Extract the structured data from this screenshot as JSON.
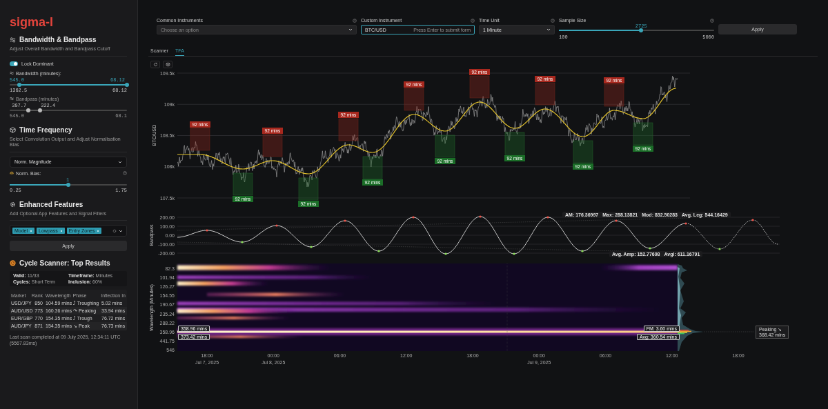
{
  "logo": "sigma-l",
  "bandwidth_section": {
    "title": "Bandwidth & Bandpass",
    "subtitle": "Adjust Overall Bandwidth and Bandpass Cutoff",
    "toggle": {
      "label": "Lock Dominant",
      "on": true
    },
    "bandwidth": {
      "label": "Bandwidth (minutes):",
      "disabled": false,
      "thumbs": [
        {
          "value": "545.0",
          "level": 0.08
        },
        {
          "value": "68.12",
          "level": 1
        }
      ],
      "min": "1362.5",
      "max": "68.12"
    },
    "bandpass": {
      "label": "Bandpass (minutes)",
      "disabled": true,
      "thumbs": [
        {
          "value": "397.7",
          "level": 0.16
        },
        {
          "value": "322.4",
          "level": 0.26
        }
      ],
      "min": "545.0",
      "max": "68.1"
    }
  },
  "time_frequency": {
    "title": "Time Frequency",
    "subtitle": "Select Convolution Output and Adjust Normalisation Bias",
    "select": "Norm. Magnitude",
    "bias": {
      "label": "Norm. Bias:",
      "value": "1",
      "level": 0.5,
      "min": "0.25",
      "max": "1.75"
    }
  },
  "enhanced_features": {
    "title": "Enhanced Features",
    "subtitle": "Add Optional App Features and Signal Filters",
    "tags": [
      "Model",
      "Lowpass",
      "Entry Zones"
    ],
    "apply": "Apply"
  },
  "cycle_scanner": {
    "title": "Cycle Scanner: Top Results",
    "info": [
      "**Valid:** 11/33",
      "**Timeframe:** Minutes",
      "**Cycles:** Short Term",
      "**Inclusion:** 60%"
    ],
    "columns": [
      "Market",
      "Rank",
      "Wavelength",
      "Phase",
      "Inflection In"
    ],
    "rows": [
      [
        "USD/JPY",
        "850",
        "104.59 mins",
        "⤴ Troughing",
        "5.02 mins"
      ],
      [
        "AUD/USD",
        "773",
        "160.36 mins",
        "↷ Peaking",
        "33.94 mins"
      ],
      [
        "EUR/GBP",
        "770",
        "154.35 mins",
        "⤴ Trough",
        "76.72 mins"
      ],
      [
        "AUD/JPY",
        "871",
        "154.35 mins",
        "↘ Peak",
        "76.73 mins"
      ]
    ],
    "footer": "Last scan completed at 09 July 2025, 12:34:11 UTC (5567.83ms)"
  },
  "form": {
    "fields": [
      {
        "kind": "select",
        "label": "Common Instruments",
        "placeholder": "Choose an option"
      },
      {
        "kind": "text",
        "label": "Custom Instrument",
        "value": "BTC/USD",
        "hint": "Press Enter to submit form"
      },
      {
        "kind": "select",
        "label": "Time Unit",
        "value": "1 Minute"
      },
      {
        "kind": "slider",
        "label": "Sample Size",
        "value": "2725",
        "level": 0.53,
        "min": "100",
        "max": "5000"
      }
    ],
    "apply": "Apply"
  },
  "tabs": [
    {
      "label": "Scanner",
      "selected": false
    },
    {
      "label": "TFA",
      "selected": true
    }
  ],
  "price_chart": {
    "ylabel": "BTC/USD",
    "yticks": [
      "109.5k",
      "109k",
      "108.5k",
      "108k",
      "107.5k"
    ],
    "zones": [
      {
        "kind": "peak",
        "label": "92 mins"
      },
      {
        "kind": "trough",
        "label": "92 mins"
      },
      {
        "kind": "peak",
        "label": "92 mins"
      },
      {
        "kind": "trough",
        "label": "92 mins"
      },
      {
        "kind": "peak",
        "label": "92 mins"
      },
      {
        "kind": "trough",
        "label": "92 mins"
      },
      {
        "kind": "peak",
        "label": "92 mins"
      },
      {
        "kind": "trough",
        "label": "92 mins"
      },
      {
        "kind": "peak",
        "label": "92 mins"
      },
      {
        "kind": "trough",
        "label": "92 mins"
      },
      {
        "kind": "peak",
        "label": "92 mins"
      },
      {
        "kind": "trough",
        "label": "92 mins"
      },
      {
        "kind": "peak",
        "label": "92 mins"
      },
      {
        "kind": "trough",
        "label": "92 mins"
      }
    ]
  },
  "bandpass_chart": {
    "ylabel": "Bandpass",
    "yticks": [
      "200.00",
      "100.00",
      "0.00",
      "-100.00",
      "-200.00"
    ],
    "stats_top": [
      "AM: 176.36997",
      "Max: 288.13821",
      "Mod: 832.50283",
      "Avg. Leg: 544.16429"
    ],
    "stats_bottom": [
      "Avg. Amp: 152.77698",
      "AvgI: 611.16791"
    ]
  },
  "spectrogram": {
    "ylabel": "Wavelength (Minutes)",
    "yticks": [
      "82.3",
      "101.94",
      "126.27",
      "154.55",
      "190.67",
      "235.24",
      "288.22",
      "358.96",
      "441.75",
      "546"
    ],
    "xticks": [
      {
        "time": "18:00",
        "date": "Jul 7, 2025"
      },
      {
        "time": "00:00",
        "date": "Jul 8, 2025"
      },
      {
        "time": "06:00"
      },
      {
        "time": "12:00"
      },
      {
        "time": "18:00"
      },
      {
        "time": "00:00",
        "date": "Jul 9, 2025"
      },
      {
        "time": "06:00"
      },
      {
        "time": "12:00"
      },
      {
        "time": "18:00"
      }
    ],
    "left_labels": [
      "358.96 mins",
      "373.42 mins"
    ],
    "right_labels": [
      "FM: 3.60 mins",
      "Avg: 360.54 mins"
    ],
    "status": {
      "label": "Peaking ↘",
      "value": "368.42 mins"
    }
  }
}
